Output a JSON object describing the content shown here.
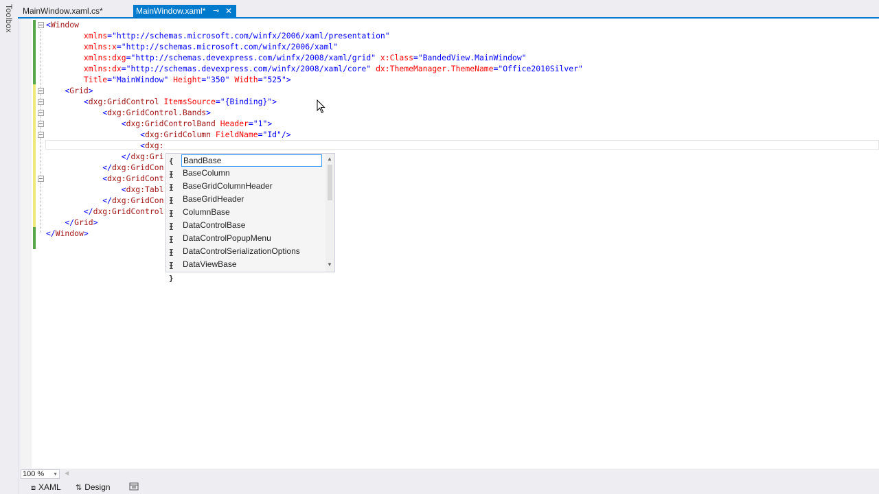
{
  "toolbox": {
    "label": "Toolbox"
  },
  "tabs": [
    {
      "label": "MainWindow.xaml.cs*",
      "active": false
    },
    {
      "label": "MainWindow.xaml*",
      "active": true
    }
  ],
  "tab_pin_glyph": "⊸",
  "tab_close_glyph": "✕",
  "code_lines": [
    [
      {
        "t": "<",
        "c": "punct"
      },
      {
        "t": "Window",
        "c": "tag"
      }
    ],
    [
      {
        "t": "        ",
        "c": "tag"
      },
      {
        "t": "xmlns",
        "c": "attr"
      },
      {
        "t": "=",
        "c": "punct"
      },
      {
        "t": "\"http://schemas.microsoft.com/winfx/2006/xaml/presentation\"",
        "c": "val"
      }
    ],
    [
      {
        "t": "        ",
        "c": "tag"
      },
      {
        "t": "xmlns:x",
        "c": "attr"
      },
      {
        "t": "=",
        "c": "punct"
      },
      {
        "t": "\"http://schemas.microsoft.com/winfx/2006/xaml\"",
        "c": "val"
      }
    ],
    [
      {
        "t": "        ",
        "c": "tag"
      },
      {
        "t": "xmlns:dxg",
        "c": "attr"
      },
      {
        "t": "=",
        "c": "punct"
      },
      {
        "t": "\"http://schemas.devexpress.com/winfx/2008/xaml/grid\"",
        "c": "val"
      },
      {
        "t": " x:Class",
        "c": "attr"
      },
      {
        "t": "=",
        "c": "punct"
      },
      {
        "t": "\"BandedView.MainWindow\"",
        "c": "val"
      }
    ],
    [
      {
        "t": "        ",
        "c": "tag"
      },
      {
        "t": "xmlns:dx",
        "c": "attr"
      },
      {
        "t": "=",
        "c": "punct"
      },
      {
        "t": "\"http://schemas.devexpress.com/winfx/2008/xaml/core\"",
        "c": "val"
      },
      {
        "t": " dx:ThemeManager.ThemeName",
        "c": "attr"
      },
      {
        "t": "=",
        "c": "punct"
      },
      {
        "t": "\"Office2010Silver\"",
        "c": "val"
      }
    ],
    [
      {
        "t": "        ",
        "c": "tag"
      },
      {
        "t": "Title",
        "c": "attr"
      },
      {
        "t": "=",
        "c": "punct"
      },
      {
        "t": "\"MainWindow\"",
        "c": "val"
      },
      {
        "t": " Height",
        "c": "attr"
      },
      {
        "t": "=",
        "c": "punct"
      },
      {
        "t": "\"350\"",
        "c": "val"
      },
      {
        "t": " Width",
        "c": "attr"
      },
      {
        "t": "=",
        "c": "punct"
      },
      {
        "t": "\"525\"",
        "c": "val"
      },
      {
        "t": ">",
        "c": "punct"
      }
    ],
    [
      {
        "t": "    ",
        "c": "tag"
      },
      {
        "t": "<",
        "c": "punct"
      },
      {
        "t": "Grid",
        "c": "tag"
      },
      {
        "t": ">",
        "c": "punct"
      }
    ],
    [
      {
        "t": "        ",
        "c": "tag"
      },
      {
        "t": "<",
        "c": "punct"
      },
      {
        "t": "dxg:GridControl",
        "c": "tag"
      },
      {
        "t": " ItemsSource",
        "c": "attr"
      },
      {
        "t": "=",
        "c": "punct"
      },
      {
        "t": "\"{Binding}\"",
        "c": "val"
      },
      {
        "t": ">",
        "c": "punct"
      }
    ],
    [
      {
        "t": "            ",
        "c": "tag"
      },
      {
        "t": "<",
        "c": "punct"
      },
      {
        "t": "dxg:GridControl.Bands",
        "c": "tag"
      },
      {
        "t": ">",
        "c": "punct"
      }
    ],
    [
      {
        "t": "                ",
        "c": "tag"
      },
      {
        "t": "<",
        "c": "punct"
      },
      {
        "t": "dxg:GridControlBand",
        "c": "tag"
      },
      {
        "t": " Header",
        "c": "attr"
      },
      {
        "t": "=",
        "c": "punct"
      },
      {
        "t": "\"1\"",
        "c": "val"
      },
      {
        "t": ">",
        "c": "punct"
      }
    ],
    [
      {
        "t": "                    ",
        "c": "tag"
      },
      {
        "t": "<",
        "c": "punct"
      },
      {
        "t": "dxg:GridColumn",
        "c": "tag"
      },
      {
        "t": " FieldName",
        "c": "attr"
      },
      {
        "t": "=",
        "c": "punct"
      },
      {
        "t": "\"Id\"",
        "c": "val"
      },
      {
        "t": "/>",
        "c": "punct"
      }
    ],
    [
      {
        "t": "                    ",
        "c": "tag"
      },
      {
        "t": "<",
        "c": "punct"
      },
      {
        "t": "dxg:",
        "c": "tag"
      }
    ],
    [
      {
        "t": "                ",
        "c": "tag"
      },
      {
        "t": "</",
        "c": "punct"
      },
      {
        "t": "dxg:Gri",
        "c": "tag"
      }
    ],
    [
      {
        "t": "            ",
        "c": "tag"
      },
      {
        "t": "</",
        "c": "punct"
      },
      {
        "t": "dxg:GridCon",
        "c": "tag"
      }
    ],
    [
      {
        "t": "            ",
        "c": "tag"
      },
      {
        "t": "<",
        "c": "punct"
      },
      {
        "t": "dxg:GridCont",
        "c": "tag"
      }
    ],
    [
      {
        "t": "                ",
        "c": "tag"
      },
      {
        "t": "<",
        "c": "punct"
      },
      {
        "t": "dxg:Tabl",
        "c": "tag"
      }
    ],
    [
      {
        "t": "            ",
        "c": "tag"
      },
      {
        "t": "</",
        "c": "punct"
      },
      {
        "t": "dxg:GridCon",
        "c": "tag"
      }
    ],
    [
      {
        "t": "        ",
        "c": "tag"
      },
      {
        "t": "</",
        "c": "punct"
      },
      {
        "t": "dxg:GridControl",
        "c": "tag"
      }
    ],
    [
      {
        "t": "    ",
        "c": "tag"
      },
      {
        "t": "</",
        "c": "punct"
      },
      {
        "t": "Grid",
        "c": "tag"
      },
      {
        "t": ">",
        "c": "punct"
      }
    ],
    [
      {
        "t": "</",
        "c": "punct"
      },
      {
        "t": "Window",
        "c": "tag"
      },
      {
        "t": ">",
        "c": "punct"
      }
    ]
  ],
  "completion": {
    "icon": "{ }",
    "items": [
      "BandBase",
      "BaseColumn",
      "BaseGridColumnHeader",
      "BaseGridHeader",
      "ColumnBase",
      "DataControlBase",
      "DataControlPopupMenu",
      "DataControlSerializationOptions",
      "DataViewBase"
    ],
    "selected_index": 0
  },
  "zoom": {
    "value": "100 %"
  },
  "view_tabs": [
    {
      "label": "XAML",
      "icon": "⧈"
    },
    {
      "label": "Design",
      "icon": "⇅"
    }
  ],
  "colors": {
    "accent": "#007ACC",
    "change_saved": "#57A64A",
    "change_unsaved": "#EFE87A",
    "tag": "#A31515",
    "attr": "#FF0000",
    "value": "#0000FF"
  }
}
